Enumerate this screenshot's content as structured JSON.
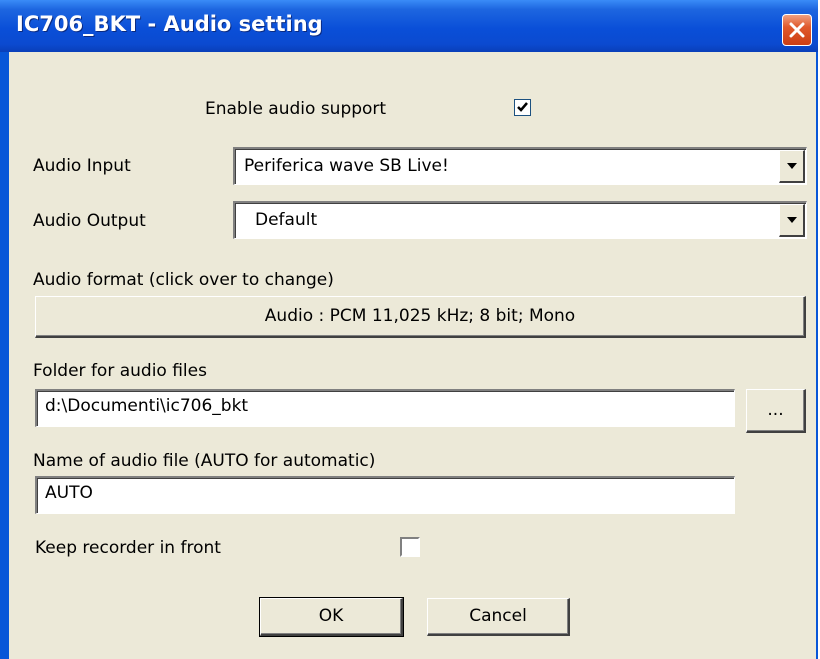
{
  "window": {
    "title": "IC706_BKT - Audio setting"
  },
  "enable_audio": {
    "label": "Enable audio support",
    "checked": true
  },
  "audio_input": {
    "label": "Audio Input",
    "value": "Periferica wave SB Live!"
  },
  "audio_output": {
    "label": "Audio Output",
    "value": "Default"
  },
  "audio_format": {
    "label": "Audio format (click over to change)",
    "button_label": "Audio : PCM 11,025 kHz; 8 bit; Mono"
  },
  "folder": {
    "label": "Folder for audio files",
    "value": "d:\\Documenti\\ic706_bkt",
    "browse_label": "..."
  },
  "file_name": {
    "label": "Name of audio file (AUTO for automatic)",
    "value": "AUTO"
  },
  "keep_front": {
    "label": "Keep recorder in front",
    "checked": false
  },
  "buttons": {
    "ok": "OK",
    "cancel": "Cancel"
  }
}
